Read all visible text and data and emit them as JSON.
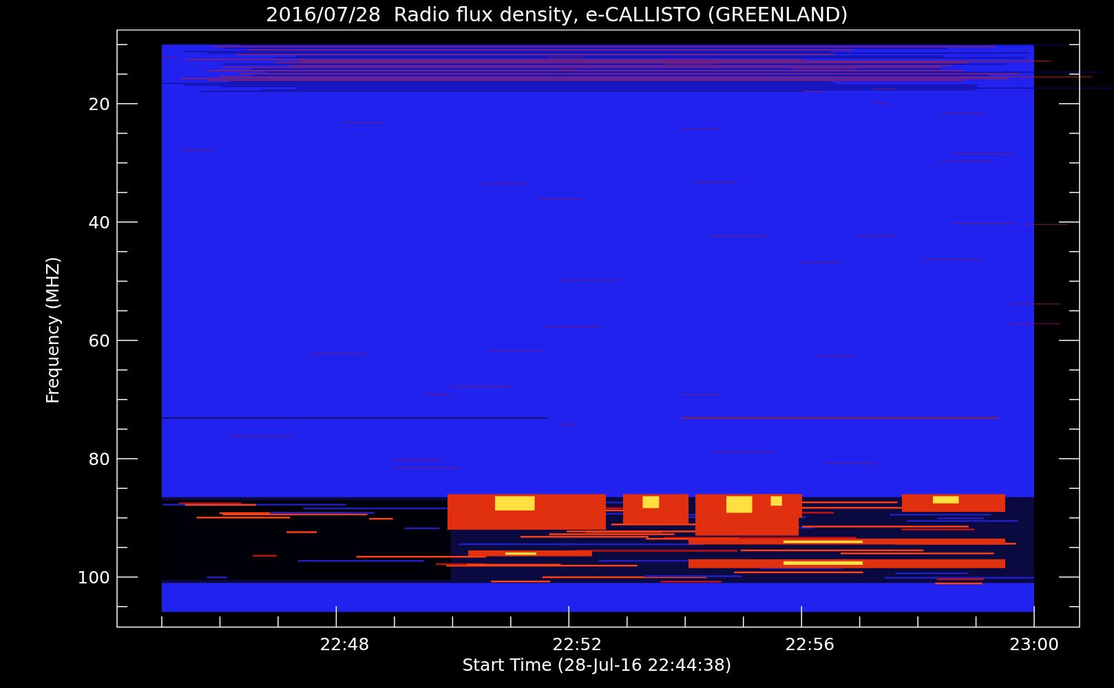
{
  "title": "2016/07/28  Radio flux density, e-CALLISTO (GREENLAND)",
  "plot": {
    "ylabel": "Frequency (MHZ)",
    "xlabel": "Start Time (28-Jul-16 22:44:38)",
    "yticks": [
      "20",
      "40",
      "60",
      "80",
      "100"
    ],
    "xticks": [
      "22:48",
      "22:52",
      "22:56",
      "23:00"
    ]
  }
}
